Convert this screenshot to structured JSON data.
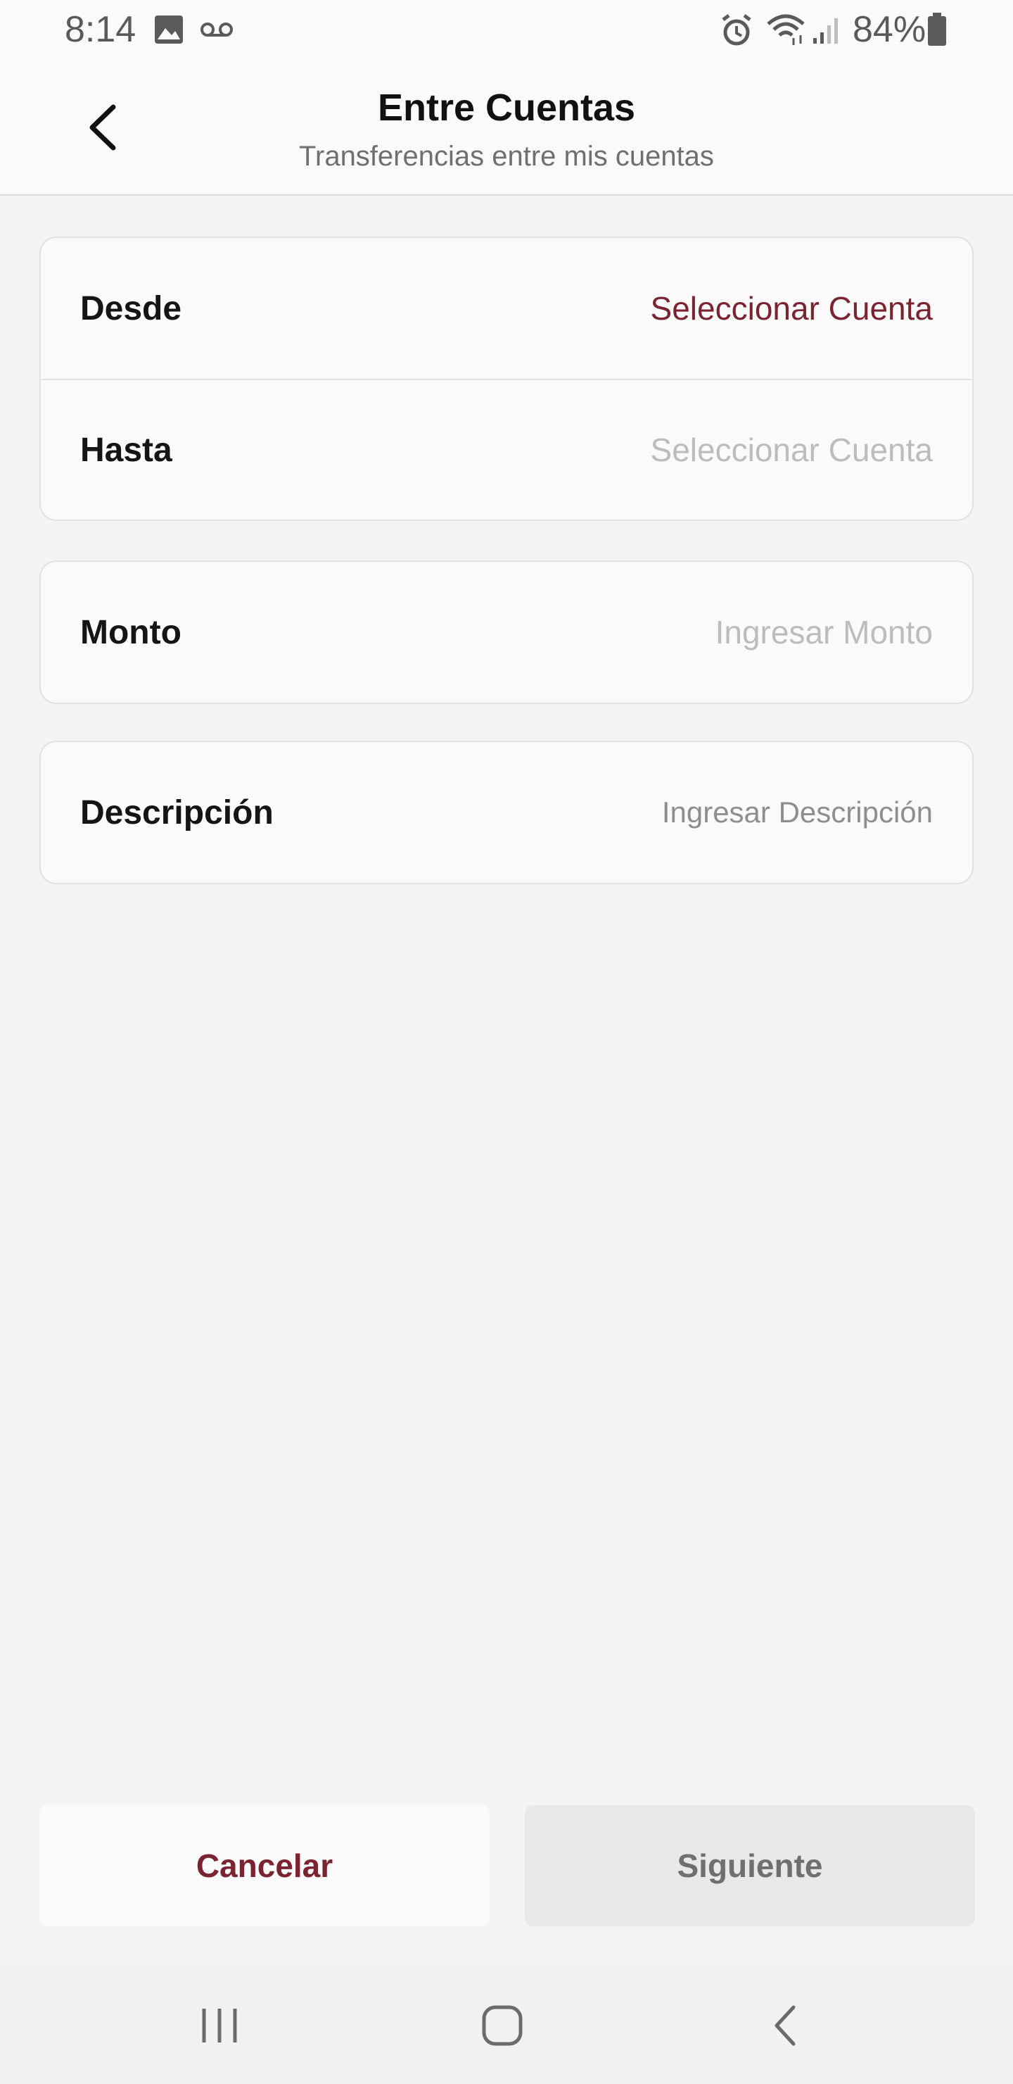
{
  "status_bar": {
    "time": "8:14",
    "battery": "84%",
    "icons": [
      "image-icon",
      "voicemail-icon",
      "alarm-icon",
      "wifi-icon",
      "signal-icon",
      "battery-icon"
    ]
  },
  "header": {
    "title": "Entre Cuentas",
    "subtitle": "Transferencias entre mis cuentas",
    "back_icon": "chevron-left-icon"
  },
  "accounts_card": {
    "from": {
      "label": "Desde",
      "value": "Seleccionar Cuenta"
    },
    "to": {
      "label": "Hasta",
      "value": "Seleccionar Cuenta"
    }
  },
  "amount_card": {
    "label": "Monto",
    "placeholder": "Ingresar Monto"
  },
  "description_card": {
    "label": "Descripción",
    "placeholder": "Ingresar Descripción"
  },
  "actions": {
    "cancel_label": "Cancelar",
    "next_label": "Siguiente"
  },
  "nav_bar": {
    "icons": [
      "recent-apps-icon",
      "home-icon",
      "back-icon"
    ]
  },
  "colors": {
    "accent": "#7a2431",
    "background": "#f4f4f4",
    "card": "#fafafa",
    "disabled_text": "#bcbcbc"
  }
}
